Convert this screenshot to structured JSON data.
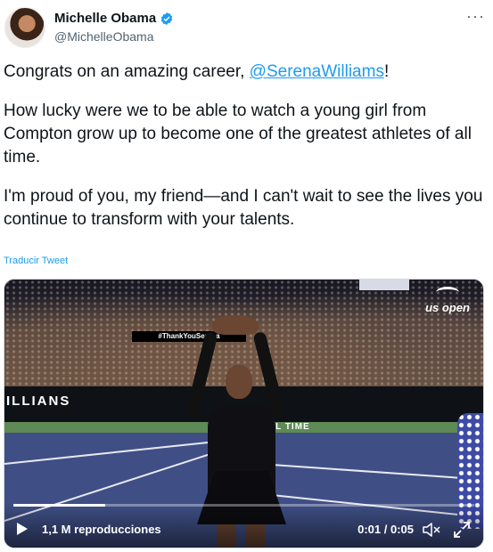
{
  "author": {
    "display_name": "Michelle Obama",
    "handle": "@MichelleObama",
    "verified_icon": "verified-badge-icon",
    "more_icon": "more-options-icon",
    "more_symbol": "···"
  },
  "tweet": {
    "line1_prefix": "Congrats on an amazing career, ",
    "mention": "@SerenaWilliams",
    "line1_suffix": "!",
    "paragraph2": "How lucky were we to be able to watch a young girl from Compton grow up to become one of the greatest athletes of all time.",
    "paragraph3": "I'm proud of you, my friend—and I can't wait to see the lives you continue to transform with your talents.",
    "translate_label": "Traducir Tweet"
  },
  "video": {
    "brand": "us open",
    "arena_banner": "ILLIANS",
    "arena_banner2": "LL TIME",
    "hashtag": "#ThankYouSerena",
    "views_label": "1,1 M reproducciones",
    "time_label": "0:01 / 0:05",
    "progress": 0.2,
    "play_icon": "play-icon",
    "mute_icon": "mute-icon",
    "fullscreen_icon": "fullscreen-icon"
  },
  "colors": {
    "link": "#1d9bf0",
    "text": "#0f1419",
    "secondary": "#536471"
  }
}
